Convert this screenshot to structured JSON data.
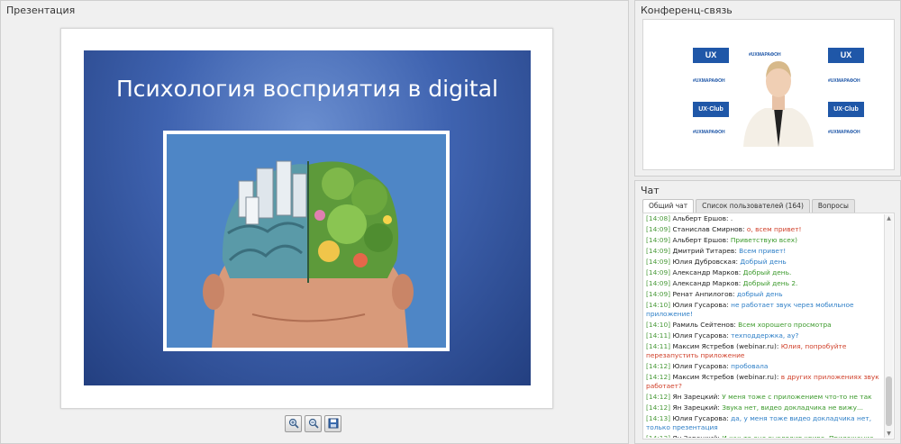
{
  "presentation": {
    "title": "Презентация",
    "slide_title": "Психология восприятия в digital",
    "toolbar": [
      {
        "name": "zoom-in-icon"
      },
      {
        "name": "zoom-out-icon"
      },
      {
        "name": "save-icon"
      }
    ]
  },
  "conference": {
    "title": "Конференц-связь",
    "logos": {
      "ux": "UX",
      "ux_sub": "МАРАФОН",
      "club": "UX·Club",
      "hashtag": "#UXMАРАФОН"
    }
  },
  "chat": {
    "title": "Чат",
    "tabs": [
      {
        "label": "Общий чат",
        "active": true
      },
      {
        "label": "Список пользователей (164)",
        "active": false
      },
      {
        "label": "Вопросы",
        "active": false
      }
    ],
    "messages": [
      {
        "time": "[14:08]",
        "author": "Альберт Ершов:",
        "text": ".",
        "color": "#333333"
      },
      {
        "time": "[14:09]",
        "author": "Станислав Смирнов:",
        "text": "о, всем привет!",
        "color": "#d0412b"
      },
      {
        "time": "[14:09]",
        "author": "Альберт Ершов:",
        "text": "Приветствую всех)",
        "color": "#3c9a2c"
      },
      {
        "time": "[14:09]",
        "author": "Дмитрий Титарев:",
        "text": "Всем привет!",
        "color": "#2e7fc7"
      },
      {
        "time": "[14:09]",
        "author": "Юлия Дубровская:",
        "text": "Добрый день",
        "color": "#2e7fc7"
      },
      {
        "time": "[14:09]",
        "author": "Александр Марков:",
        "text": "Добрый день.",
        "color": "#3c9a2c"
      },
      {
        "time": "[14:09]",
        "author": "Александр Марков:",
        "text": "Добрый день 2.",
        "color": "#3c9a2c"
      },
      {
        "time": "[14:09]",
        "author": "Ренат Анпилогов:",
        "text": "добрый день",
        "color": "#2e7fc7"
      },
      {
        "time": "[14:10]",
        "author": "Юлия Гусарова:",
        "text": "не работает звук через мобильное приложение!",
        "color": "#2e7fc7"
      },
      {
        "time": "[14:10]",
        "author": "Рамиль Сейтенов:",
        "text": "Всем хорошего просмотра",
        "color": "#3c9a2c"
      },
      {
        "time": "[14:11]",
        "author": "Юлия Гусарова:",
        "text": "техподдержка, ау?",
        "color": "#2e7fc7"
      },
      {
        "time": "[14:11]",
        "author": "Максим Ястребов (webinar.ru):",
        "text": "Юлия, попробуйте перезапустить приложение",
        "color": "#d0412b"
      },
      {
        "time": "[14:12]",
        "author": "Юлия Гусарова:",
        "text": "пробовала",
        "color": "#2e7fc7"
      },
      {
        "time": "[14:12]",
        "author": "Максим Ястребов (webinar.ru):",
        "text": "в других приложениях звук работает?",
        "color": "#d0412b"
      },
      {
        "time": "[14:12]",
        "author": "Ян Зарецкий:",
        "text": "У меня тоже с приложением что-то не так",
        "color": "#3c9a2c"
      },
      {
        "time": "[14:12]",
        "author": "Ян Зарецкий:",
        "text": "Звука нет, видео докладчика не вижу...",
        "color": "#3c9a2c"
      },
      {
        "time": "[14:13]",
        "author": "Юлия Гусарова:",
        "text": "да, у меня тоже видео докладчика нет, только презентация",
        "color": "#2e7fc7"
      },
      {
        "time": "[14:13]",
        "author": "Ян Зарецкий:",
        "text": "И как-то оно выглядит криво. Приложение может просто сырое и глючит?",
        "color": "#3c9a2c"
      }
    ]
  }
}
